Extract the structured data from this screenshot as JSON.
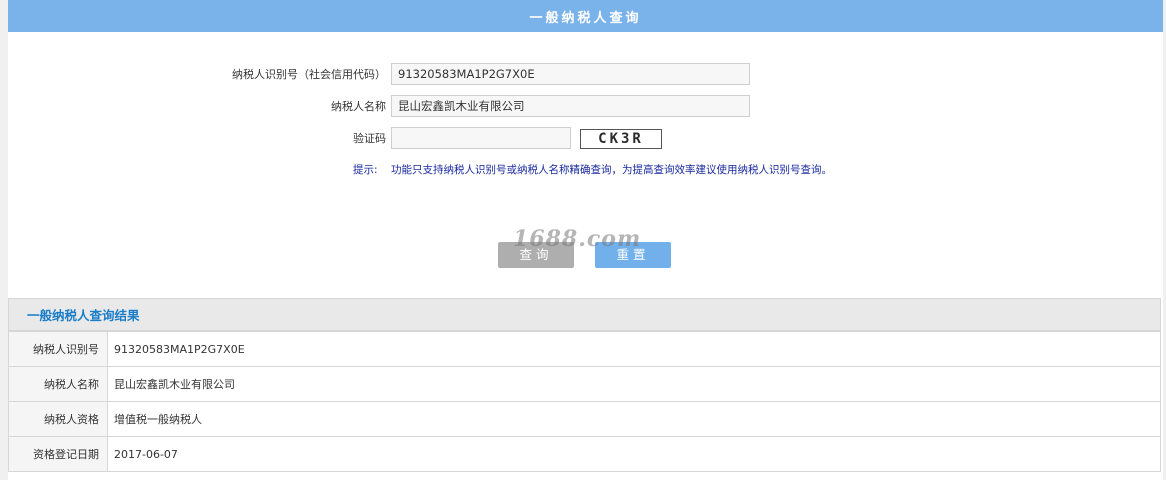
{
  "header": {
    "title": "一般纳税人查询"
  },
  "form": {
    "taxpayer_id_label": "纳税人识别号（社会信用代码）",
    "taxpayer_id_value": "91320583MA1P2G7X0E",
    "taxpayer_name_label": "纳税人名称",
    "taxpayer_name_value": "昆山宏鑫凯木业有限公司",
    "captcha_label": "验证码",
    "captcha_value": "",
    "captcha_image_text": "CK3R",
    "tip_label": "提示:",
    "tip_text": "功能只支持纳税人识别号或纳税人名称精确查询，为提高查询效率建议使用纳税人识别号查询。"
  },
  "buttons": {
    "query": "查询",
    "reset": "重置"
  },
  "watermark": "1688.com",
  "result": {
    "title": "一般纳税人查询结果",
    "rows": [
      {
        "label": "纳税人识别号",
        "value": "91320583MA1P2G7X0E"
      },
      {
        "label": "纳税人名称",
        "value": "昆山宏鑫凯木业有限公司"
      },
      {
        "label": "纳税人资格",
        "value": "增值税一般纳税人"
      },
      {
        "label": "资格登记日期",
        "value": "2017-06-07"
      }
    ]
  },
  "colors": {
    "banner": "#7ab2ea",
    "query_button": "#aeaeae",
    "reset_button": "#72b0ec",
    "tip_text": "#1a2a9e",
    "result_title": "#1a7dc8"
  }
}
